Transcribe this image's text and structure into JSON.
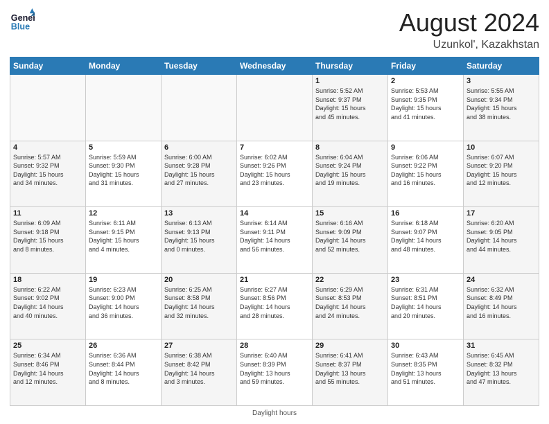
{
  "header": {
    "logo_line1": "General",
    "logo_line2": "Blue",
    "main_title": "August 2024",
    "subtitle": "Uzunkol', Kazakhstan"
  },
  "calendar": {
    "days_of_week": [
      "Sunday",
      "Monday",
      "Tuesday",
      "Wednesday",
      "Thursday",
      "Friday",
      "Saturday"
    ],
    "weeks": [
      [
        {
          "day": "",
          "info": ""
        },
        {
          "day": "",
          "info": ""
        },
        {
          "day": "",
          "info": ""
        },
        {
          "day": "",
          "info": ""
        },
        {
          "day": "1",
          "info": "Sunrise: 5:52 AM\nSunset: 9:37 PM\nDaylight: 15 hours\nand 45 minutes."
        },
        {
          "day": "2",
          "info": "Sunrise: 5:53 AM\nSunset: 9:35 PM\nDaylight: 15 hours\nand 41 minutes."
        },
        {
          "day": "3",
          "info": "Sunrise: 5:55 AM\nSunset: 9:34 PM\nDaylight: 15 hours\nand 38 minutes."
        }
      ],
      [
        {
          "day": "4",
          "info": "Sunrise: 5:57 AM\nSunset: 9:32 PM\nDaylight: 15 hours\nand 34 minutes."
        },
        {
          "day": "5",
          "info": "Sunrise: 5:59 AM\nSunset: 9:30 PM\nDaylight: 15 hours\nand 31 minutes."
        },
        {
          "day": "6",
          "info": "Sunrise: 6:00 AM\nSunset: 9:28 PM\nDaylight: 15 hours\nand 27 minutes."
        },
        {
          "day": "7",
          "info": "Sunrise: 6:02 AM\nSunset: 9:26 PM\nDaylight: 15 hours\nand 23 minutes."
        },
        {
          "day": "8",
          "info": "Sunrise: 6:04 AM\nSunset: 9:24 PM\nDaylight: 15 hours\nand 19 minutes."
        },
        {
          "day": "9",
          "info": "Sunrise: 6:06 AM\nSunset: 9:22 PM\nDaylight: 15 hours\nand 16 minutes."
        },
        {
          "day": "10",
          "info": "Sunrise: 6:07 AM\nSunset: 9:20 PM\nDaylight: 15 hours\nand 12 minutes."
        }
      ],
      [
        {
          "day": "11",
          "info": "Sunrise: 6:09 AM\nSunset: 9:18 PM\nDaylight: 15 hours\nand 8 minutes."
        },
        {
          "day": "12",
          "info": "Sunrise: 6:11 AM\nSunset: 9:15 PM\nDaylight: 15 hours\nand 4 minutes."
        },
        {
          "day": "13",
          "info": "Sunrise: 6:13 AM\nSunset: 9:13 PM\nDaylight: 15 hours\nand 0 minutes."
        },
        {
          "day": "14",
          "info": "Sunrise: 6:14 AM\nSunset: 9:11 PM\nDaylight: 14 hours\nand 56 minutes."
        },
        {
          "day": "15",
          "info": "Sunrise: 6:16 AM\nSunset: 9:09 PM\nDaylight: 14 hours\nand 52 minutes."
        },
        {
          "day": "16",
          "info": "Sunrise: 6:18 AM\nSunset: 9:07 PM\nDaylight: 14 hours\nand 48 minutes."
        },
        {
          "day": "17",
          "info": "Sunrise: 6:20 AM\nSunset: 9:05 PM\nDaylight: 14 hours\nand 44 minutes."
        }
      ],
      [
        {
          "day": "18",
          "info": "Sunrise: 6:22 AM\nSunset: 9:02 PM\nDaylight: 14 hours\nand 40 minutes."
        },
        {
          "day": "19",
          "info": "Sunrise: 6:23 AM\nSunset: 9:00 PM\nDaylight: 14 hours\nand 36 minutes."
        },
        {
          "day": "20",
          "info": "Sunrise: 6:25 AM\nSunset: 8:58 PM\nDaylight: 14 hours\nand 32 minutes."
        },
        {
          "day": "21",
          "info": "Sunrise: 6:27 AM\nSunset: 8:56 PM\nDaylight: 14 hours\nand 28 minutes."
        },
        {
          "day": "22",
          "info": "Sunrise: 6:29 AM\nSunset: 8:53 PM\nDaylight: 14 hours\nand 24 minutes."
        },
        {
          "day": "23",
          "info": "Sunrise: 6:31 AM\nSunset: 8:51 PM\nDaylight: 14 hours\nand 20 minutes."
        },
        {
          "day": "24",
          "info": "Sunrise: 6:32 AM\nSunset: 8:49 PM\nDaylight: 14 hours\nand 16 minutes."
        }
      ],
      [
        {
          "day": "25",
          "info": "Sunrise: 6:34 AM\nSunset: 8:46 PM\nDaylight: 14 hours\nand 12 minutes."
        },
        {
          "day": "26",
          "info": "Sunrise: 6:36 AM\nSunset: 8:44 PM\nDaylight: 14 hours\nand 8 minutes."
        },
        {
          "day": "27",
          "info": "Sunrise: 6:38 AM\nSunset: 8:42 PM\nDaylight: 14 hours\nand 3 minutes."
        },
        {
          "day": "28",
          "info": "Sunrise: 6:40 AM\nSunset: 8:39 PM\nDaylight: 13 hours\nand 59 minutes."
        },
        {
          "day": "29",
          "info": "Sunrise: 6:41 AM\nSunset: 8:37 PM\nDaylight: 13 hours\nand 55 minutes."
        },
        {
          "day": "30",
          "info": "Sunrise: 6:43 AM\nSunset: 8:35 PM\nDaylight: 13 hours\nand 51 minutes."
        },
        {
          "day": "31",
          "info": "Sunrise: 6:45 AM\nSunset: 8:32 PM\nDaylight: 13 hours\nand 47 minutes."
        }
      ]
    ]
  },
  "footer": {
    "text": "Daylight hours"
  }
}
